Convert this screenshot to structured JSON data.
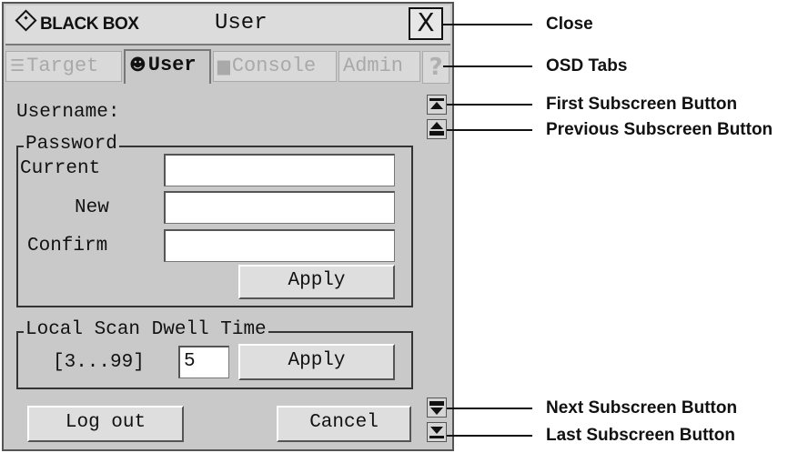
{
  "window": {
    "logo_text": "BLACK BOX",
    "title": "User",
    "close_glyph": "X"
  },
  "tabs": [
    {
      "label": "Target",
      "icon": "target-list-icon",
      "active": false
    },
    {
      "label": "User",
      "icon": "user-head-icon",
      "active": true
    },
    {
      "label": "Console",
      "icon": "console-monitor-icon",
      "active": false
    },
    {
      "label": "Admin",
      "icon": "",
      "active": false
    }
  ],
  "help_tab": {
    "glyph": "?"
  },
  "form": {
    "username_label": "Username:",
    "password_legend": "Password",
    "current_label": "Current",
    "new_label": "New",
    "confirm_label": "Confirm",
    "current_value": "",
    "new_value": "",
    "confirm_value": "",
    "password_apply": "Apply",
    "scan_legend": "Local Scan Dwell Time",
    "scan_range": "[3...99]",
    "scan_value": "5",
    "scan_apply": "Apply",
    "logout": "Log out",
    "cancel": "Cancel"
  },
  "callouts": {
    "close": "Close",
    "osd_tabs": "OSD Tabs",
    "first": "First Subscreen Button",
    "previous": "Previous Subscreen Button",
    "next": "Next Subscreen Button",
    "last": "Last Subscreen Button"
  }
}
